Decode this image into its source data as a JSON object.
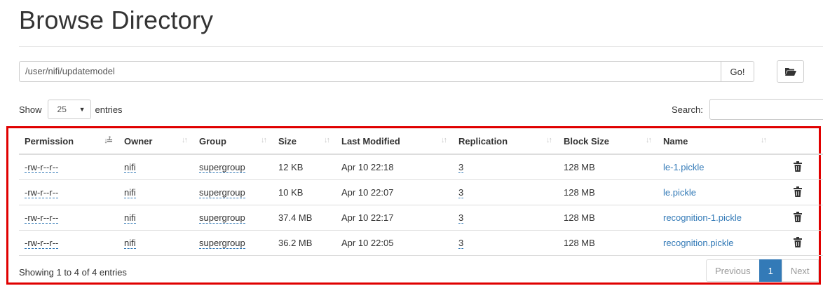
{
  "page": {
    "title": "Browse Directory"
  },
  "path_bar": {
    "value": "/user/nifi/updatemodel",
    "go_label": "Go!",
    "folder_icon": "folder-open-icon"
  },
  "entries": {
    "show_label": "Show",
    "selected": "25",
    "entries_label": "entries"
  },
  "search": {
    "label": "Search:",
    "value": ""
  },
  "table": {
    "headers": [
      "Permission",
      "Owner",
      "Group",
      "Size",
      "Last Modified",
      "Replication",
      "Block Size",
      "Name"
    ],
    "rows": [
      {
        "permission": "-rw-r--r--",
        "owner": "nifi",
        "group": "supergroup",
        "size": "12 KB",
        "modified": "Apr 10 22:18",
        "replication": "3",
        "block_size": "128 MB",
        "name": "le-1.pickle"
      },
      {
        "permission": "-rw-r--r--",
        "owner": "nifi",
        "group": "supergroup",
        "size": "10 KB",
        "modified": "Apr 10 22:07",
        "replication": "3",
        "block_size": "128 MB",
        "name": "le.pickle"
      },
      {
        "permission": "-rw-r--r--",
        "owner": "nifi",
        "group": "supergroup",
        "size": "37.4 MB",
        "modified": "Apr 10 22:17",
        "replication": "3",
        "block_size": "128 MB",
        "name": "recognition-1.pickle"
      },
      {
        "permission": "-rw-r--r--",
        "owner": "nifi",
        "group": "supergroup",
        "size": "36.2 MB",
        "modified": "Apr 10 22:05",
        "replication": "3",
        "block_size": "128 MB",
        "name": "recognition.pickle"
      }
    ]
  },
  "footer": {
    "info": "Showing 1 to 4 of 4 entries",
    "pager": {
      "previous": "Previous",
      "current": "1",
      "next": "Next"
    }
  },
  "colors": {
    "link": "#337ab7",
    "highlight_border": "#e00000",
    "pager_active": "#337ab7"
  }
}
